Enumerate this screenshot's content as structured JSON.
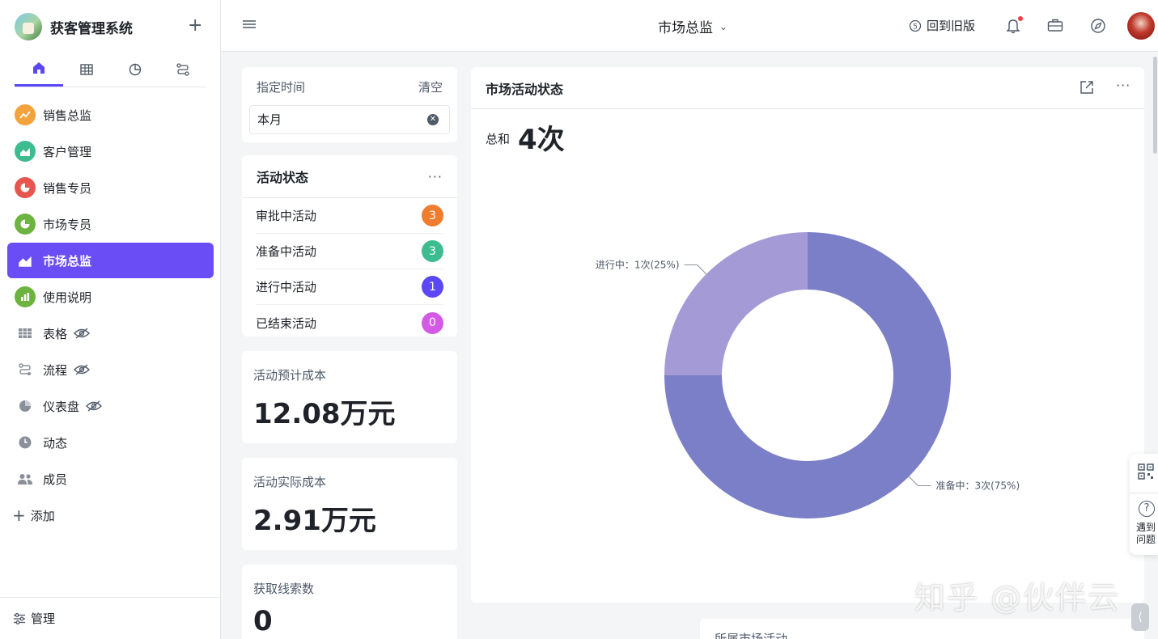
{
  "app": {
    "title": "获客管理系统",
    "add_icon": "plus-icon"
  },
  "side_tabs": [
    {
      "name": "home",
      "icon": "home-icon",
      "active": true
    },
    {
      "name": "table",
      "icon": "table-icon",
      "active": false
    },
    {
      "name": "chart",
      "icon": "pie-icon",
      "active": false
    },
    {
      "name": "flow",
      "icon": "flow-icon",
      "active": false
    }
  ],
  "nav": {
    "items": [
      {
        "label": "销售总监",
        "color": "#f3a33b",
        "icon": "trend-icon"
      },
      {
        "label": "客户管理",
        "color": "#3dbd8f",
        "icon": "area-chart-icon"
      },
      {
        "label": "销售专员",
        "color": "#e8554e",
        "icon": "pie-icon"
      },
      {
        "label": "市场专员",
        "color": "#6db33f",
        "icon": "pie-icon"
      },
      {
        "label": "市场总监",
        "color": "#6a4df4",
        "icon": "area-chart-icon",
        "active": true
      },
      {
        "label": "使用说明",
        "color": "#6db33f",
        "icon": "bar-chart-icon"
      },
      {
        "label": "表格",
        "icon": "table-icon",
        "hidden": true
      },
      {
        "label": "流程",
        "icon": "flow-icon",
        "hidden": true
      },
      {
        "label": "仪表盘",
        "icon": "pie-icon",
        "hidden": true
      },
      {
        "label": "动态",
        "icon": "clock-icon"
      },
      {
        "label": "成员",
        "icon": "members-icon"
      }
    ],
    "add_label": "添加"
  },
  "manage_label": "管理",
  "topbar": {
    "page_title": "市场总监",
    "old_version": "回到旧版"
  },
  "filter": {
    "label": "指定时间",
    "clear": "清空",
    "value": "本月"
  },
  "activity_status": {
    "title": "活动状态",
    "rows": [
      {
        "label": "审批中活动",
        "count": "3",
        "color": "#f07c2e"
      },
      {
        "label": "准备中活动",
        "count": "3",
        "color": "#3dbd8f"
      },
      {
        "label": "进行中活动",
        "count": "1",
        "color": "#5b47f5"
      },
      {
        "label": "已结束活动",
        "count": "0",
        "color": "#d45ae6"
      }
    ]
  },
  "metrics": [
    {
      "label": "活动预计成本",
      "value": "12.08万元"
    },
    {
      "label": "活动实际成本",
      "value": "2.91万元"
    },
    {
      "label": "获取线索数",
      "value": "0"
    }
  ],
  "chart_card": {
    "title": "市场活动状态",
    "total_label": "总和",
    "total_value": "4次"
  },
  "chart_data": {
    "type": "pie",
    "donut": true,
    "categories": [
      "准备中",
      "进行中"
    ],
    "values": [
      3,
      1
    ],
    "percentages": [
      75,
      25
    ],
    "labels": [
      "准备中：3次(75%)",
      "进行中：1次(25%)"
    ],
    "colors": [
      "#7b7fc7",
      "#a49ad6"
    ],
    "title": "市场活动状态"
  },
  "bottom_card": {
    "title": "所属市场活动"
  },
  "watermark": "知乎 @伙伴云",
  "float_panel": {
    "help_text": "遇到问题"
  }
}
